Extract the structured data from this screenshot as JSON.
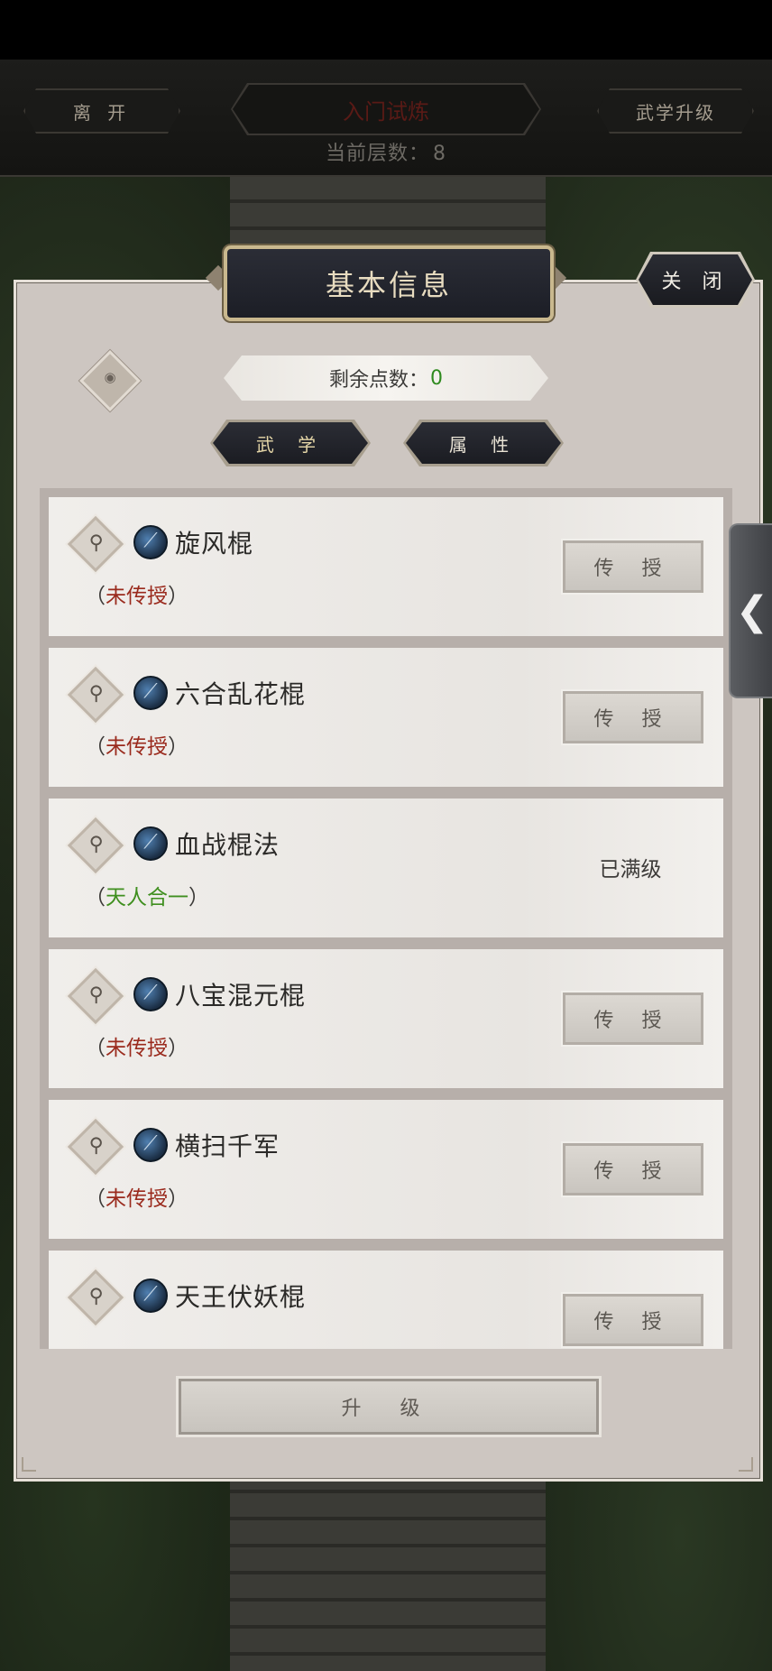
{
  "topbar": {
    "leave_label": "离 开",
    "title": "入门试炼",
    "upgrade_label": "武学升级",
    "floor_label": "当前层数：",
    "floor_value": "8"
  },
  "panel": {
    "title": "基本信息",
    "close_label": "关 闭",
    "points_label": "剩余点数：",
    "points_value": "0",
    "tabs": [
      {
        "label": "武 学"
      },
      {
        "label": "属 性"
      }
    ],
    "skills": [
      {
        "name": "旋风棍",
        "status_prefix": "（",
        "status": "未传授",
        "status_suffix": "）",
        "action": "传 授"
      },
      {
        "name": "六合乱花棍",
        "status_prefix": "（",
        "status": "未传授",
        "status_suffix": "）",
        "action": "传 授"
      },
      {
        "name": "血战棍法",
        "status_prefix": "（",
        "status": "天人合一",
        "status_suffix": "）",
        "action": "已满级"
      },
      {
        "name": "八宝混元棍",
        "status_prefix": "（",
        "status": "未传授",
        "status_suffix": "）",
        "action": "传 授"
      },
      {
        "name": "横扫千军",
        "status_prefix": "（",
        "status": "未传授",
        "status_suffix": "）",
        "action": "传 授"
      },
      {
        "name": "天王伏妖棍",
        "status_prefix": "",
        "status": "",
        "status_suffix": "",
        "action": "传 授"
      }
    ],
    "upgrade_label": "升 级"
  },
  "icons": {
    "eye": "eye-icon",
    "magnifier": "magnifier-icon",
    "skill": "staff-skill-icon",
    "side_tab": "chevron-left-icon"
  },
  "colors": {
    "status_unlearned": "#9a2a1d",
    "status_maxed": "#3f8f1f",
    "points_value": "#2e8a1e"
  }
}
